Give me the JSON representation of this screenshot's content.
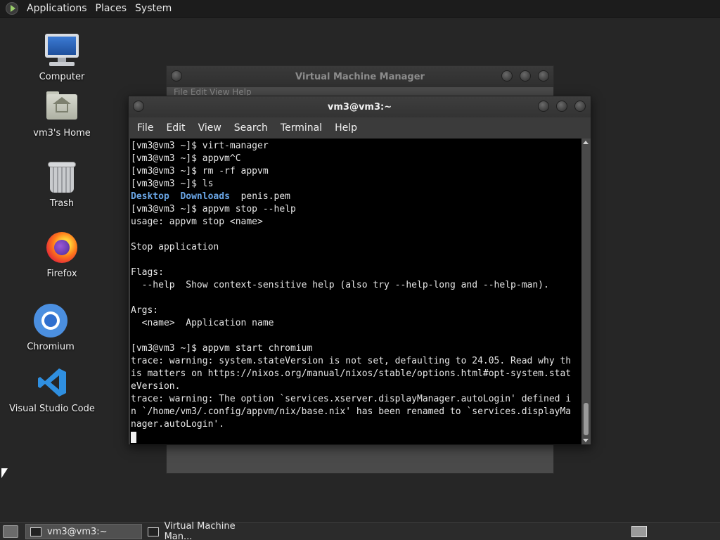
{
  "top_panel": {
    "menus": [
      "Applications",
      "Places",
      "System"
    ]
  },
  "desktop_icons": [
    {
      "label": "Computer",
      "icon": "computer-icon"
    },
    {
      "label": "vm3's Home",
      "icon": "home-folder-icon"
    },
    {
      "label": "Trash",
      "icon": "trash-icon"
    },
    {
      "label": "Firefox",
      "icon": "firefox-icon"
    },
    {
      "label": "Chromium",
      "icon": "chromium-icon"
    },
    {
      "label": "Visual Studio Code",
      "icon": "vscode-icon"
    }
  ],
  "vmm_window": {
    "title": "Virtual Machine Manager",
    "menu_partial": "File   Edit   View   Help"
  },
  "terminal": {
    "title": "vm3@vm3:~",
    "menu": [
      "File",
      "Edit",
      "View",
      "Search",
      "Terminal",
      "Help"
    ],
    "lines": [
      "[vm3@vm3 ~]$ virt-manager",
      "[vm3@vm3 ~]$ appvm^C",
      "[vm3@vm3 ~]$ rm -rf appvm",
      "[vm3@vm3 ~]$ ls",
      "",
      "[vm3@vm3 ~]$ appvm stop --help",
      "usage: appvm stop <name>",
      "",
      "Stop application",
      "",
      "Flags:",
      "  --help  Show context-sensitive help (also try --help-long and --help-man).",
      "",
      "Args:",
      "  <name>  Application name",
      "",
      "[vm3@vm3 ~]$ appvm start chromium",
      "trace: warning: system.stateVersion is not set, defaulting to 24.05. Read why th",
      "is matters on https://nixos.org/manual/nixos/stable/options.html#opt-system.stat",
      "eVersion.",
      "trace: warning: The option `services.xserver.displayManager.autoLogin' defined i",
      "n `/home/vm3/.config/appvm/nix/base.nix' has been renamed to `services.displayMa",
      "nager.autoLogin'."
    ],
    "ls_output": {
      "dir1": "Desktop",
      "dir2": "Downloads",
      "file1": "penis.pem"
    }
  },
  "taskbar": {
    "items": [
      "vm3@vm3:~",
      "Virtual Machine Man..."
    ]
  },
  "colors": {
    "desktop_bg": "#262626",
    "terminal_bg": "#000000",
    "dir_color": "#6aa6e6"
  }
}
